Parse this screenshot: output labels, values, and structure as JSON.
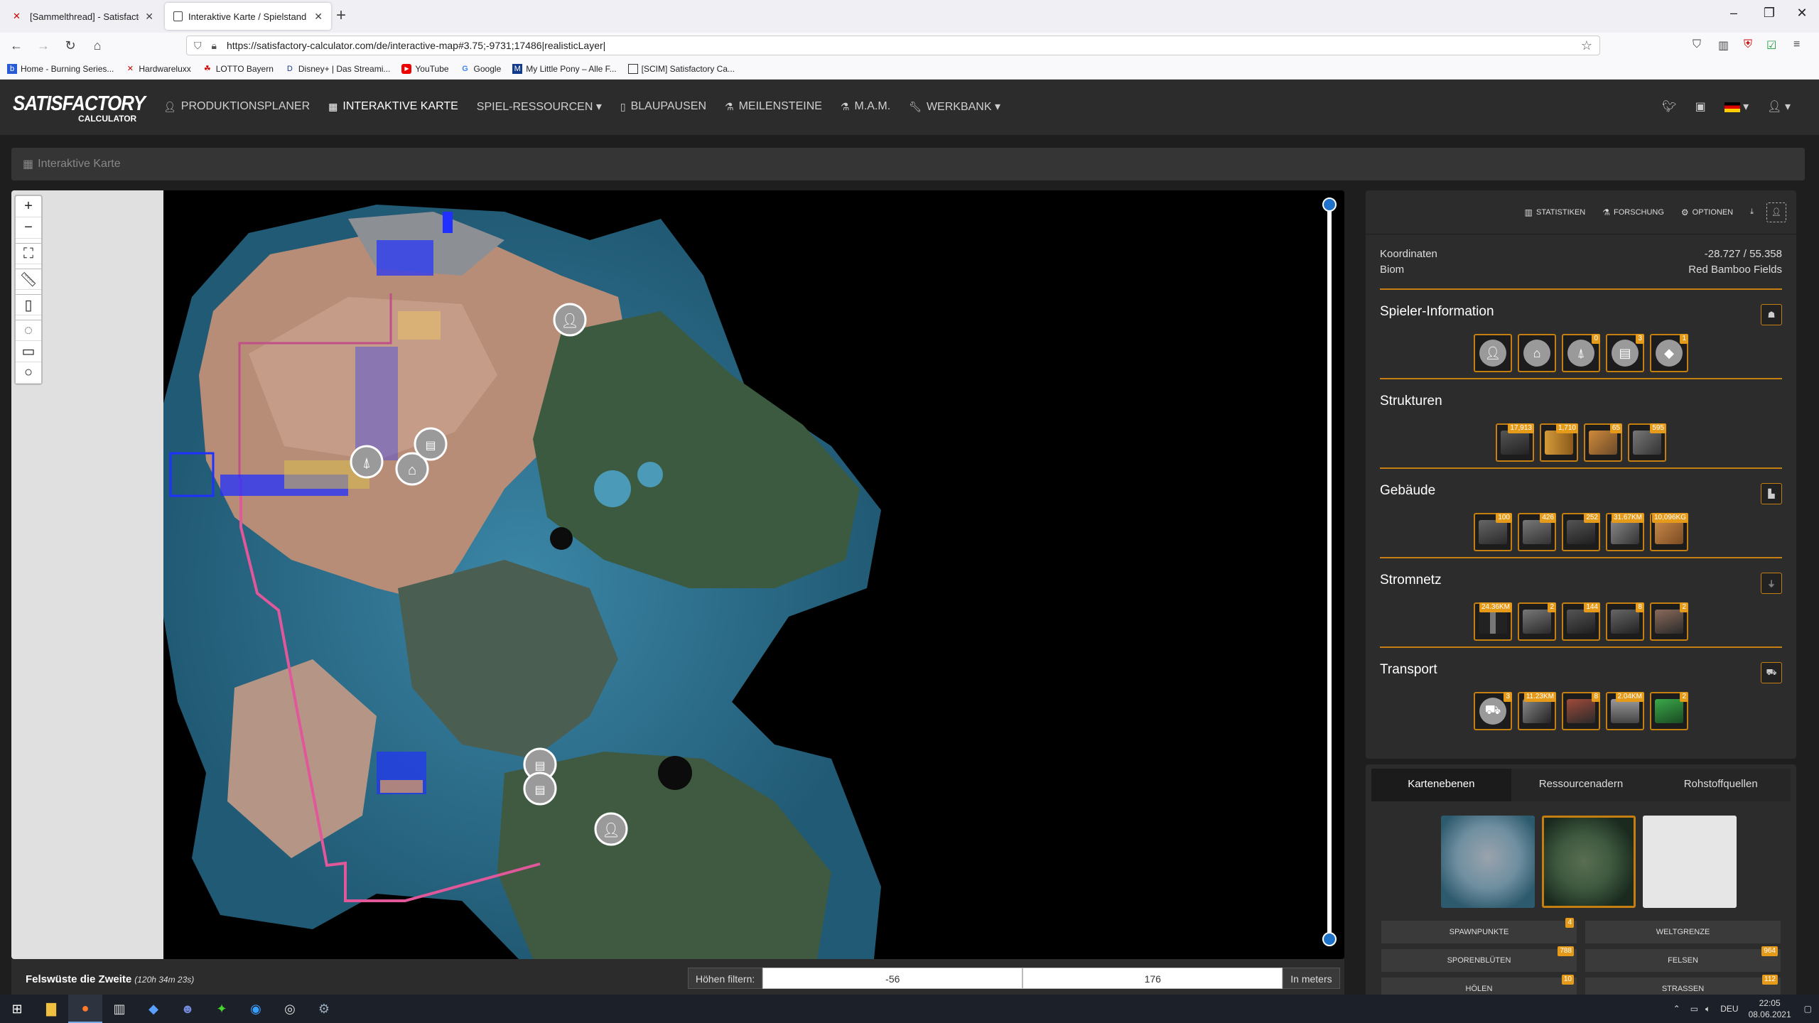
{
  "browser": {
    "tabs": [
      {
        "title": "[Sammelthread] - Satisfactory |"
      },
      {
        "title": "Interaktive Karte / Spielstand Ed"
      }
    ],
    "url": "https://satisfactory-calculator.com/de/interactive-map#3.75;-9731;17486|realisticLayer|",
    "bookmarks": [
      {
        "label": "Home - Burning Series..."
      },
      {
        "label": "Hardwareluxx"
      },
      {
        "label": "LOTTO Bayern"
      },
      {
        "label": "Disney+ | Das Streami..."
      },
      {
        "label": "YouTube"
      },
      {
        "label": "Google"
      },
      {
        "label": "My Little Pony – Alle F..."
      },
      {
        "label": "[SCIM] Satisfactory Ca..."
      }
    ]
  },
  "site": {
    "logo": {
      "line1": "SATISFACTORY",
      "line2": "CALCULATOR"
    },
    "nav": [
      {
        "label": "PRODUKTIONSPLANER"
      },
      {
        "label": "INTERAKTIVE KARTE"
      },
      {
        "label": "SPIEL-RESSOURCEN ▾"
      },
      {
        "label": "BLAUPAUSEN"
      },
      {
        "label": "MEILENSTEINE"
      },
      {
        "label": "M.A.M."
      },
      {
        "label": "WERKBANK ▾"
      }
    ],
    "breadcrumb": "Interaktive Karte"
  },
  "map": {
    "save_name": "Felswüste die Zweite",
    "playtime": "(120h 34m 23s)",
    "height_filter_label": "Höhen filtern:",
    "height_min": "-56",
    "height_max": "176",
    "height_unit": "In meters"
  },
  "panel": {
    "buttons": {
      "stats": "STATISTIKEN",
      "research": "FORSCHUNG",
      "options": "OPTIONEN"
    },
    "coords_label": "Koordinaten",
    "coords_value": "-28.727 / 55.358",
    "biome_label": "Biom",
    "biome_value": "Red Bamboo Fields",
    "sections": {
      "player": {
        "title": "Spieler-Information",
        "badges": [
          "",
          "",
          "0",
          "3",
          "1"
        ]
      },
      "structures": {
        "title": "Strukturen",
        "badges": [
          "17,913",
          "1,710",
          "65",
          "595"
        ]
      },
      "buildings": {
        "title": "Gebäude",
        "badges": [
          "100",
          "426",
          "252",
          "31.67KM",
          "10,096KG"
        ]
      },
      "power": {
        "title": "Stromnetz",
        "badges": [
          "24.36KM",
          "2",
          "144",
          "8",
          "2"
        ]
      },
      "transport": {
        "title": "Transport",
        "badges": [
          "3",
          "11.23KM",
          "8",
          "2.04KM",
          "2"
        ]
      }
    }
  },
  "layers": {
    "tabs": [
      "Kartenebenen",
      "Ressourcenadern",
      "Rohstoffquellen"
    ],
    "buttons": [
      {
        "label": "SPAWNPUNKTE",
        "badge": "4"
      },
      {
        "label": "WELTGRENZE",
        "badge": ""
      },
      {
        "label": "SPORENBLÜTEN",
        "badge": "788"
      },
      {
        "label": "FELSEN",
        "badge": "964"
      },
      {
        "label": "HÖLEN",
        "badge": "10"
      },
      {
        "label": "STRASSEN",
        "badge": "112"
      }
    ]
  },
  "taskbar": {
    "lang": "DEU",
    "time": "22:05",
    "date": "08.06.2021"
  },
  "colors": {
    "accent": "#c47f10",
    "badge": "#e69a1a",
    "slider": "#1e73c8",
    "railway": "#e0589a"
  }
}
